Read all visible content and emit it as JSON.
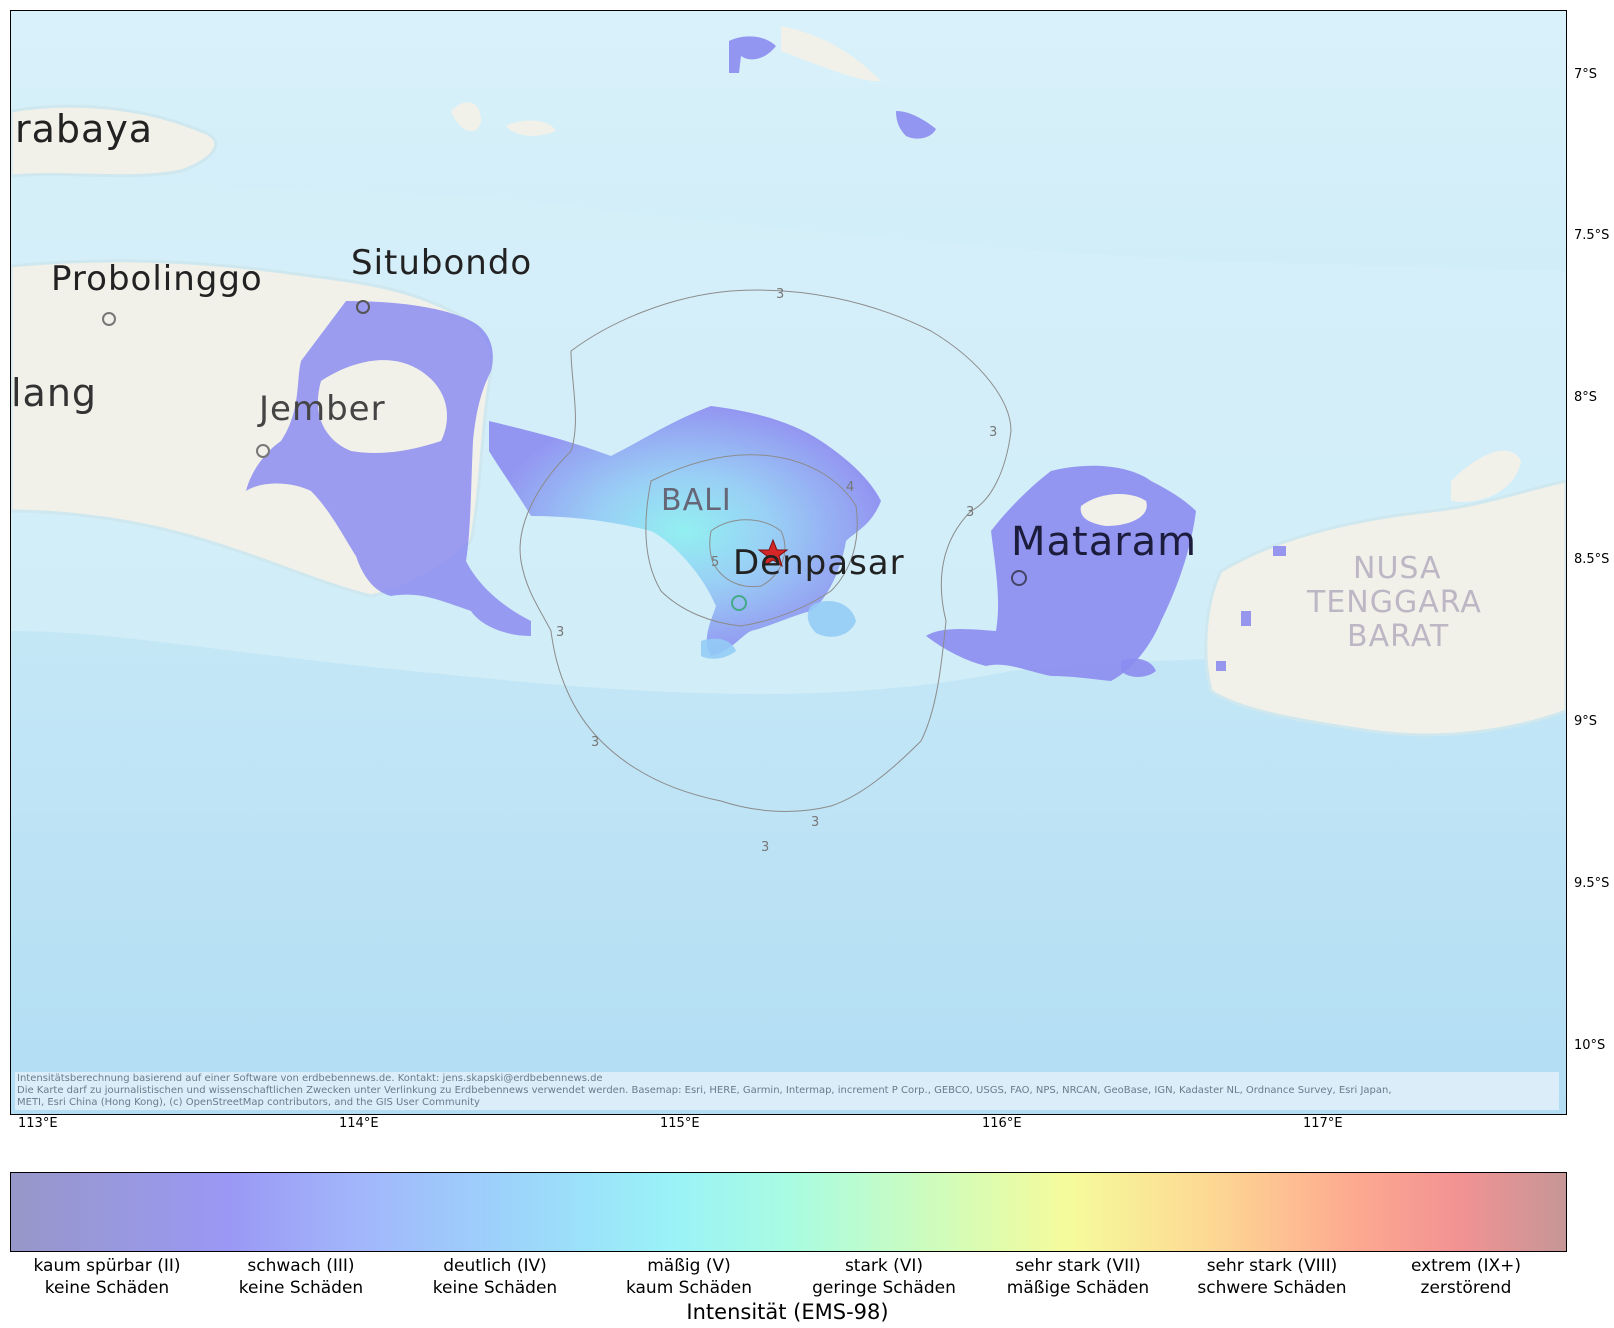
{
  "map": {
    "lat_labels": [
      "7°S",
      "7.5°S",
      "8°S",
      "8.5°S",
      "9°S",
      "9.5°S",
      "10°S"
    ],
    "lon_labels": [
      "113°E",
      "114°E",
      "115°E",
      "116°E",
      "117°E"
    ],
    "places": {
      "surabaya": "rabaya",
      "probolinggo": "Probolinggo",
      "situbondo": "Situbondo",
      "lumajang": "lang",
      "jember": "Jember",
      "bali": "BALI",
      "denpasar": "Denpasar",
      "mataram": "Mataram",
      "ntb_line1": "NUSA",
      "ntb_line2": "TENGGARA",
      "ntb_line3": "BARAT"
    },
    "contour_labels": [
      "3",
      "3",
      "3",
      "3",
      "3",
      "3",
      "3",
      "5",
      "4"
    ],
    "epicenter": {
      "lon": 115.33,
      "lat": -8.5,
      "marker": "star-icon",
      "color": "#d62728"
    },
    "attribution": {
      "line1": "Intensitätsberechnung basierend auf einer Software von erdbebennews.de. Kontakt: jens.skapski@erdbebennews.de",
      "line2": "Die Karte darf zu journalistischen und wissenschaftlichen Zwecken unter Verlinkung zu Erdbebennews verwendet werden. Basemap: Esri, HERE, Garmin, Intermap, increment P Corp., GEBCO, USGS, FAO, NPS, NRCAN, GeoBase, IGN, Kadaster NL, Ordnance Survey, Esri Japan,",
      "line3": "METI, Esri China (Hong Kong), (c) OpenStreetMap contributors, and the GIS User Community"
    },
    "colors": {
      "sea": "#bfe3f3",
      "land": "#eef0e6",
      "intensity_ii": "#8c8cf0",
      "intensity_iv": "#8fe8f2",
      "contour": "#8c8c8c"
    }
  },
  "colorbar": {
    "title": "Intensität (EMS-98)",
    "levels": [
      {
        "name": "kaum spürbar (II)",
        "effect": "keine Schäden"
      },
      {
        "name": "schwach (III)",
        "effect": "keine Schäden"
      },
      {
        "name": "deutlich (IV)",
        "effect": "keine Schäden"
      },
      {
        "name": "mäßig (V)",
        "effect": "kaum Schäden"
      },
      {
        "name": "stark (VI)",
        "effect": "geringe Schäden"
      },
      {
        "name": "sehr stark (VII)",
        "effect": "mäßige Schäden"
      },
      {
        "name": "sehr stark (VIII)",
        "effect": "schwere Schäden"
      },
      {
        "name": "extrem (IX+)",
        "effect": "zerstörend"
      }
    ]
  }
}
